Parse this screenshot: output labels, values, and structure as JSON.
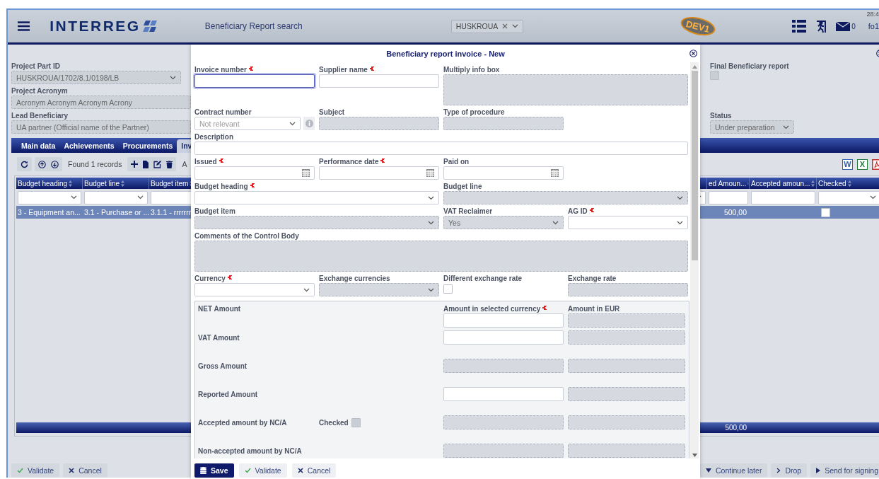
{
  "header": {
    "logo": "INTERREG",
    "title": "Beneficiary Report search",
    "project_select": {
      "value": "HUSKROUA"
    },
    "env_badge": "DEV1",
    "message_count": "0",
    "user": "fo1",
    "time": "28:4"
  },
  "project": {
    "fields": [
      {
        "label": "Project Part ID",
        "value": "HUSKROUA/1702/8.1/0198/LB",
        "kind": "select"
      },
      {
        "label": "Project Acronym",
        "value": "Acronym Acronym Acronym Acrony",
        "kind": "text"
      },
      {
        "label": "Lead Beneficiary",
        "value": "UA partner (Official name of the Partner)",
        "kind": "text"
      }
    ],
    "final_report": {
      "label": "Final Beneficiary report",
      "checked": false
    },
    "status": {
      "label": "Status",
      "value": "Under preparation"
    }
  },
  "tabs": [
    {
      "label": "Main data",
      "selected": false
    },
    {
      "label": "Achievements",
      "selected": false
    },
    {
      "label": "Procurements",
      "selected": false
    },
    {
      "label": "Inv",
      "selected": true
    }
  ],
  "toolbar": {
    "records": "Found 1 records",
    "cut_text": "A",
    "exports": [
      {
        "kind": "word",
        "label": "W"
      },
      {
        "kind": "excel",
        "label": "X"
      },
      {
        "kind": "pdf"
      }
    ]
  },
  "table": {
    "columns": [
      "Budget heading",
      "Budget line",
      "Budget item",
      "ed Amoun...",
      "Accepted amoun...",
      "Checked"
    ],
    "rows": [
      {
        "cells": [
          "3 - Equipment an...",
          "3.1 - Purchase or ...",
          "3.1.1 - rrrrrrr",
          "500,00"
        ],
        "selected": true,
        "checked": false
      }
    ],
    "footer_total": "500,00"
  },
  "page_buttons": {
    "left": [
      {
        "label": "Validate",
        "kind": "validate"
      },
      {
        "label": "Cancel",
        "kind": "cancel"
      }
    ],
    "right": [
      {
        "label": "Continue later",
        "kind": "later"
      },
      {
        "label": "Drop",
        "kind": "drop"
      },
      {
        "label": "Send for signing",
        "kind": "send"
      }
    ]
  },
  "dialog": {
    "title": "Beneficiary report invoice - New",
    "fields": [
      {
        "label": "Invoice number",
        "kind": "text",
        "required": true,
        "disabled": false,
        "focused": true
      },
      {
        "label": "Supplier name",
        "kind": "text",
        "required": true,
        "disabled": false,
        "focused": false
      },
      {
        "label": "Multiply info box",
        "kind": "textarea",
        "required": false,
        "disabled": true,
        "focused": false
      },
      {
        "label": "Contract number",
        "kind": "lookup",
        "required": false,
        "disabled": false,
        "focused": false,
        "placeholder": "Not relevant"
      },
      {
        "label": "Subject",
        "kind": "text",
        "required": false,
        "disabled": true,
        "focused": false
      },
      {
        "label": "Type of procedure",
        "kind": "text",
        "required": false,
        "disabled": true,
        "focused": false
      },
      {
        "label": "Description",
        "kind": "text",
        "required": false,
        "disabled": false,
        "focused": false
      },
      {
        "label": "Issued",
        "kind": "date",
        "required": true,
        "disabled": false,
        "focused": false
      },
      {
        "label": "Performance date",
        "kind": "date",
        "required": true,
        "disabled": false,
        "focused": false
      },
      {
        "label": "Paid on",
        "kind": "date",
        "required": false,
        "disabled": false,
        "focused": false
      },
      {
        "label": "Budget heading",
        "kind": "select",
        "required": true,
        "disabled": false,
        "focused": false
      },
      {
        "label": "Budget line",
        "kind": "select",
        "required": false,
        "disabled": true,
        "focused": false
      },
      {
        "label": "Budget item",
        "kind": "select",
        "required": false,
        "disabled": true,
        "focused": false
      },
      {
        "label": "VAT Reclaimer",
        "kind": "select",
        "required": false,
        "disabled": true,
        "focused": false,
        "value": "Yes"
      },
      {
        "label": "AG ID",
        "kind": "select",
        "required": true,
        "disabled": false,
        "focused": false
      },
      {
        "label": "Comments of the Control Body",
        "kind": "textarea",
        "required": false,
        "disabled": true,
        "focused": false
      },
      {
        "label": "Currency",
        "kind": "select",
        "required": true,
        "disabled": false,
        "focused": false
      },
      {
        "label": "Exchange currencies",
        "kind": "select",
        "required": false,
        "disabled": true,
        "focused": false
      },
      {
        "label": "Different exchange rate",
        "kind": "checkbox",
        "required": false,
        "disabled": false,
        "focused": false,
        "checked": false
      },
      {
        "label": "Exchange rate",
        "kind": "text",
        "required": false,
        "disabled": true,
        "focused": false
      }
    ],
    "amounts": {
      "columns": [
        {
          "label": "Amount in selected currency",
          "required": true
        },
        {
          "label": "Amount in EUR",
          "required": false
        }
      ],
      "rows": [
        {
          "label": "NET Amount",
          "currency_disabled": false,
          "eur_disabled": true
        },
        {
          "label": "VAT Amount",
          "currency_disabled": false,
          "eur_disabled": true
        },
        {
          "label": "Gross Amount",
          "currency_disabled": true,
          "eur_disabled": true
        },
        {
          "label": "Reported Amount",
          "currency_disabled": false,
          "eur_disabled": true
        },
        {
          "label": "Accepted amount by NC/A",
          "currency_disabled": true,
          "eur_disabled": true,
          "check": {
            "label": "Checked",
            "checked": false
          }
        },
        {
          "label": "Non-accepted amount by NC/A",
          "currency_disabled": true,
          "eur_disabled": true
        }
      ]
    },
    "buttons": [
      {
        "label": "Save",
        "kind": "save"
      },
      {
        "label": "Validate",
        "kind": "validate"
      },
      {
        "label": "Cancel",
        "kind": "cancel"
      }
    ]
  }
}
